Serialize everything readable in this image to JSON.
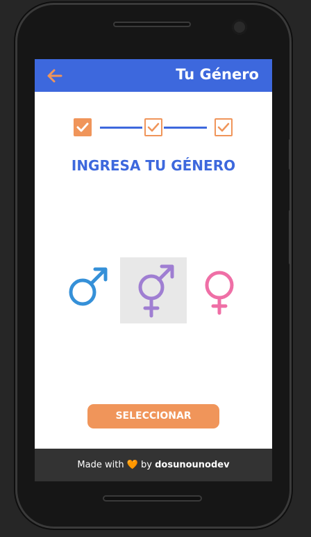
{
  "appbar": {
    "title": "Tu Género",
    "back_icon": "arrow-left-icon",
    "color": "#3d68dd",
    "back_icon_color": "#f0955a"
  },
  "steps": [
    {
      "icon": "checkbox-checked-icon",
      "state": "filled"
    },
    {
      "icon": "checkbox-checked-icon",
      "state": "outlined"
    },
    {
      "icon": "checkbox-checked-icon",
      "state": "outlined"
    }
  ],
  "heading": "INGRESA TU GÉNERO",
  "genders": [
    {
      "icon": "male-symbol-icon",
      "color": "#3590d8",
      "selected": false
    },
    {
      "icon": "transgender-symbol-icon",
      "color": "#9f7ed2",
      "selected": true
    },
    {
      "icon": "female-symbol-icon",
      "color": "#ef6fa6",
      "selected": false
    }
  ],
  "select_button": "SELECCIONAR",
  "footer": {
    "made_with": "Made with",
    "heart": "🧡",
    "by": "by",
    "author": "dosunounodev"
  },
  "colors": {
    "accent": "#f0955a",
    "primary": "#3d68dd",
    "footer_bg": "#333333"
  }
}
